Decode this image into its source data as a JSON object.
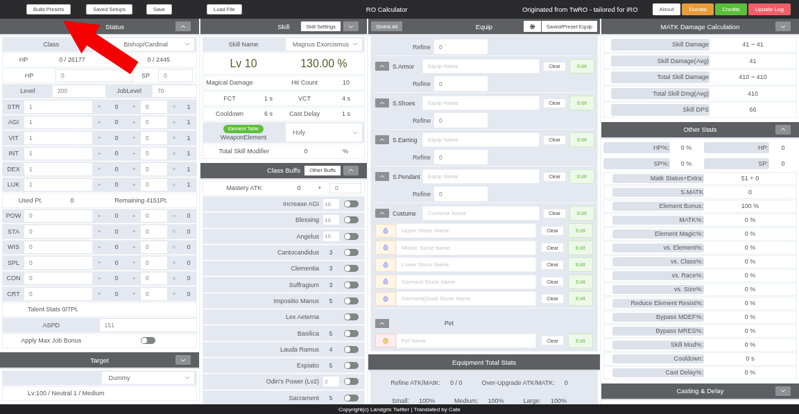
{
  "topbar": {
    "left_buttons": [
      "Build Presets",
      "Saved Setups",
      "Save",
      "Load File"
    ],
    "title": "RO Calculator",
    "tagline": "Originated from TwRO - tailored for iRO",
    "links": [
      {
        "label": "About",
        "color": "#ffffff"
      },
      {
        "label": "Donate",
        "color": "#e89c3c"
      },
      {
        "label": "Credits",
        "color": "#5cbf3a"
      },
      {
        "label": "Update Log",
        "color": "#ef5f6a"
      }
    ]
  },
  "status": {
    "header": "Status",
    "expanded": true,
    "class_label": "Class",
    "class_value": "Bishop/Cardinal",
    "hp_label": "HP",
    "hp_value": "0 / 26177",
    "sp_value": "0 / 2445",
    "bonus": {
      "hp_label": "HP",
      "hp_input": "0",
      "sp_label": "SP",
      "sp_input": "0"
    },
    "level_label": "Level",
    "level": "200",
    "job_label": "JobLevel",
    "job_level": "70",
    "stats": [
      {
        "name": "STR",
        "base": "1",
        "op1": "+",
        "bonus": "0",
        "op2": "+",
        "extra": "0",
        "op3": "=",
        "total": "1"
      },
      {
        "name": "AGI",
        "base": "1",
        "op1": "+",
        "bonus": "0",
        "op2": "+",
        "extra": "0",
        "op3": "=",
        "total": "1"
      },
      {
        "name": "VIT",
        "base": "1",
        "op1": "+",
        "bonus": "0",
        "op2": "+",
        "extra": "0",
        "op3": "=",
        "total": "1"
      },
      {
        "name": "INT",
        "base": "1",
        "op1": "+",
        "bonus": "0",
        "op2": "+",
        "extra": "0",
        "op3": "=",
        "total": "1"
      },
      {
        "name": "DEX",
        "base": "1",
        "op1": "+",
        "bonus": "0",
        "op2": "+",
        "extra": "0",
        "op3": "=",
        "total": "1"
      },
      {
        "name": "LUK",
        "base": "1",
        "op1": "+",
        "bonus": "0",
        "op2": "+",
        "extra": "0",
        "op3": "=",
        "total": "1"
      }
    ],
    "used_label": "Used Pt.",
    "used": "0",
    "remaining": "Remaining 4151Pt.",
    "traits": [
      {
        "name": "POW",
        "base": "0",
        "op1": "+",
        "bonus": "0",
        "op2": "+",
        "extra": "0",
        "op3": "=",
        "total": "0"
      },
      {
        "name": "STA",
        "base": "0",
        "op1": "+",
        "bonus": "0",
        "op2": "+",
        "extra": "0",
        "op3": "=",
        "total": "0"
      },
      {
        "name": "WIS",
        "base": "0",
        "op1": "+",
        "bonus": "0",
        "op2": "+",
        "extra": "0",
        "op3": "=",
        "total": "0"
      },
      {
        "name": "SPL",
        "base": "0",
        "op1": "+",
        "bonus": "0",
        "op2": "+",
        "extra": "0",
        "op3": "=",
        "total": "0"
      },
      {
        "name": "CON",
        "base": "0",
        "op1": "+",
        "bonus": "0",
        "op2": "+",
        "extra": "0",
        "op3": "=",
        "total": "0"
      },
      {
        "name": "CRT",
        "base": "0",
        "op1": "+",
        "bonus": "0",
        "op2": "+",
        "extra": "0",
        "op3": "=",
        "total": "0"
      }
    ],
    "talent": "Talent Stats 0/7Pt.",
    "aspd_label": "ASPD",
    "aspd": "151",
    "max_job": {
      "label": "Apply Max Job Bonus",
      "on": false
    }
  },
  "target": {
    "header": "Target",
    "expanded": false,
    "monster": "Dummy",
    "info": "Lv:100 / Neutral 1 / Medium"
  },
  "skill": {
    "header": "Skill",
    "expanded": false,
    "settings_button": "Skill Settings",
    "name_label": "Skill Name",
    "name": "Magnus Exorcismus",
    "level": "Lv 10",
    "percent": "130.00 %",
    "info_rows": [
      [
        "Magical Damage",
        "",
        "Hit Count",
        "10"
      ],
      [
        "FCT",
        "1 s",
        "VCT",
        "4 s"
      ],
      [
        "Cooldown",
        "6 s",
        "Cast Delay",
        "1 s"
      ]
    ],
    "element_button": "Element Table",
    "element_label": "WeaponElement",
    "element": "Holy",
    "modifier_label": "Total Skill Modifier",
    "modifier": "0",
    "modifier_unit": "%"
  },
  "class_buffs": {
    "header": "Class Buffs",
    "expanded": true,
    "other_button": "Other Buffs",
    "mastery_label": "Mastery ATK",
    "mastery": "0",
    "mastery_op": "+",
    "mastery_input": "0",
    "buffs": [
      {
        "name": "Increase AGI",
        "kind": "input",
        "level": "10",
        "on": false
      },
      {
        "name": "Blessing",
        "kind": "input",
        "level": "10",
        "on": false
      },
      {
        "name": "Angelus",
        "kind": "input",
        "level": "10",
        "on": false
      },
      {
        "name": "Cantocandidus",
        "kind": "level",
        "level": "3",
        "on": false
      },
      {
        "name": "Clementia",
        "kind": "level",
        "level": "3",
        "on": false
      },
      {
        "name": "Suffragium",
        "kind": "level",
        "level": "3",
        "on": false
      },
      {
        "name": "Impositio Manus",
        "kind": "level",
        "level": "5",
        "on": false
      },
      {
        "name": "Lex Aeterna",
        "kind": "none",
        "on": false
      },
      {
        "name": "Basilica",
        "kind": "level",
        "level": "5",
        "on": false
      },
      {
        "name": "Lauda Ramus",
        "kind": "level",
        "level": "4",
        "on": false
      },
      {
        "name": "Expiatio",
        "kind": "level",
        "level": "5",
        "on": false
      },
      {
        "name": "Odin's Power (Lv2)",
        "kind": "input",
        "level": "2",
        "on": false
      },
      {
        "name": "Sacrament",
        "kind": "level",
        "level": "5",
        "on": false
      }
    ]
  },
  "equip": {
    "header": "Equip",
    "shrink_button": "Shrink All",
    "saved_button": "Saved/Preset Equip",
    "top_refine_label": "Refine",
    "top_refine": "0",
    "slots": [
      {
        "name": "S.Armor",
        "expanded": true,
        "placeholder": "Equip Name",
        "clear": "Clear",
        "edit": "Edit",
        "refine_label": "Refine",
        "refine": "0"
      },
      {
        "name": "S.Shoes",
        "expanded": true,
        "placeholder": "Equip Name",
        "clear": "Clear",
        "edit": "Edit",
        "refine_label": "Refine",
        "refine": "0"
      },
      {
        "name": "S.Earring",
        "expanded": true,
        "placeholder": "Equip Name",
        "clear": "Clear",
        "edit": "Edit",
        "refine_label": "Refine",
        "refine": "0"
      },
      {
        "name": "S.Pendant",
        "expanded": true,
        "placeholder": "Equip Name",
        "clear": "Clear",
        "edit": "Edit",
        "refine_label": "Refine",
        "refine": "0"
      }
    ],
    "costume": {
      "name": "Costume",
      "expanded": true,
      "placeholder": "Costume Name",
      "clear": "Clear",
      "edit": "Edit",
      "stones": [
        {
          "placeholder": "Upper Stone Name",
          "clear": "Clear",
          "edit": "Edit"
        },
        {
          "placeholder": "Middle Stone Name",
          "clear": "Clear",
          "edit": "Edit"
        },
        {
          "placeholder": "Lower Stone Name",
          "clear": "Clear",
          "edit": "Edit"
        },
        {
          "placeholder": "Garment Stone Name",
          "clear": "Clear",
          "edit": "Edit"
        },
        {
          "placeholder": "Garment(Dual) Stone Name",
          "clear": "Clear",
          "edit": "Edit"
        }
      ]
    },
    "pet": {
      "name": "Pet",
      "expanded": true,
      "placeholder": "Pet Name",
      "clear": "Clear",
      "edit": "Edit"
    }
  },
  "equipment_totals": {
    "header": "Equipment Total Stats",
    "rows": [
      [
        {
          "label": "Refine ATK/MAtK:",
          "value": "0 / 0"
        },
        {
          "label": "Over-Upgrade ATK/MATK:",
          "value": "0"
        }
      ],
      [
        {
          "label": "Small:",
          "value": "100%"
        },
        {
          "label": "Medium:",
          "value": "100%"
        },
        {
          "label": "Large:",
          "value": "100%"
        }
      ]
    ]
  },
  "matk": {
    "header": "MATK Damage Calculation",
    "expanded": false,
    "results": [
      {
        "label": "Skill Damage",
        "value": "41 ~ 41"
      },
      {
        "label": "Skill Damage(Avg)",
        "value": "41"
      },
      {
        "label": "Total Skill Damage",
        "value": "410 ~ 410"
      },
      {
        "label": "Total Skill Dmg(Avg)",
        "value": "410"
      },
      {
        "label": "Skill DPS",
        "value": "66"
      }
    ]
  },
  "other_stats": {
    "header": "Other Stats",
    "expanded": true,
    "pairs": [
      [
        {
          "label": "HP%:",
          "value": "0 %"
        },
        {
          "label": "HP:",
          "value": "0"
        }
      ],
      [
        {
          "label": "SP%:",
          "value": "0 %"
        },
        {
          "label": "SP:",
          "value": "0"
        }
      ]
    ],
    "rows": [
      {
        "label": "Matk Status+Extra:",
        "value": "51 + 0"
      },
      {
        "label": "S.MATK",
        "value": "0"
      },
      {
        "label": "Element Bonus:",
        "value": "100 %"
      },
      {
        "label": "MATK%:",
        "value": "0 %"
      },
      {
        "label": "Element Magic%:",
        "value": "0 %"
      },
      {
        "label": "vs. Element%:",
        "value": "0 %"
      },
      {
        "label": "vs. Class%:",
        "value": "0 %"
      },
      {
        "label": "vs. Race%:",
        "value": "0 %"
      },
      {
        "label": "vs. Size%:",
        "value": "0 %"
      },
      {
        "label": "Reduce Element Resist%:",
        "value": "0 %"
      },
      {
        "label": "Bypass MDEF%:",
        "value": "0 %"
      },
      {
        "label": "Bypass MRES%:",
        "value": "0 %"
      },
      {
        "label": "Skill Mod%:",
        "value": "0 %"
      },
      {
        "label": "Cooldown:",
        "value": "0 s"
      },
      {
        "label": "Cast Delay%:",
        "value": "0 %"
      }
    ]
  },
  "casting": {
    "header": "Casting & Delay",
    "expanded": false
  },
  "footer": "Copyright(c) Landgris Twitter | Translated by Cate"
}
